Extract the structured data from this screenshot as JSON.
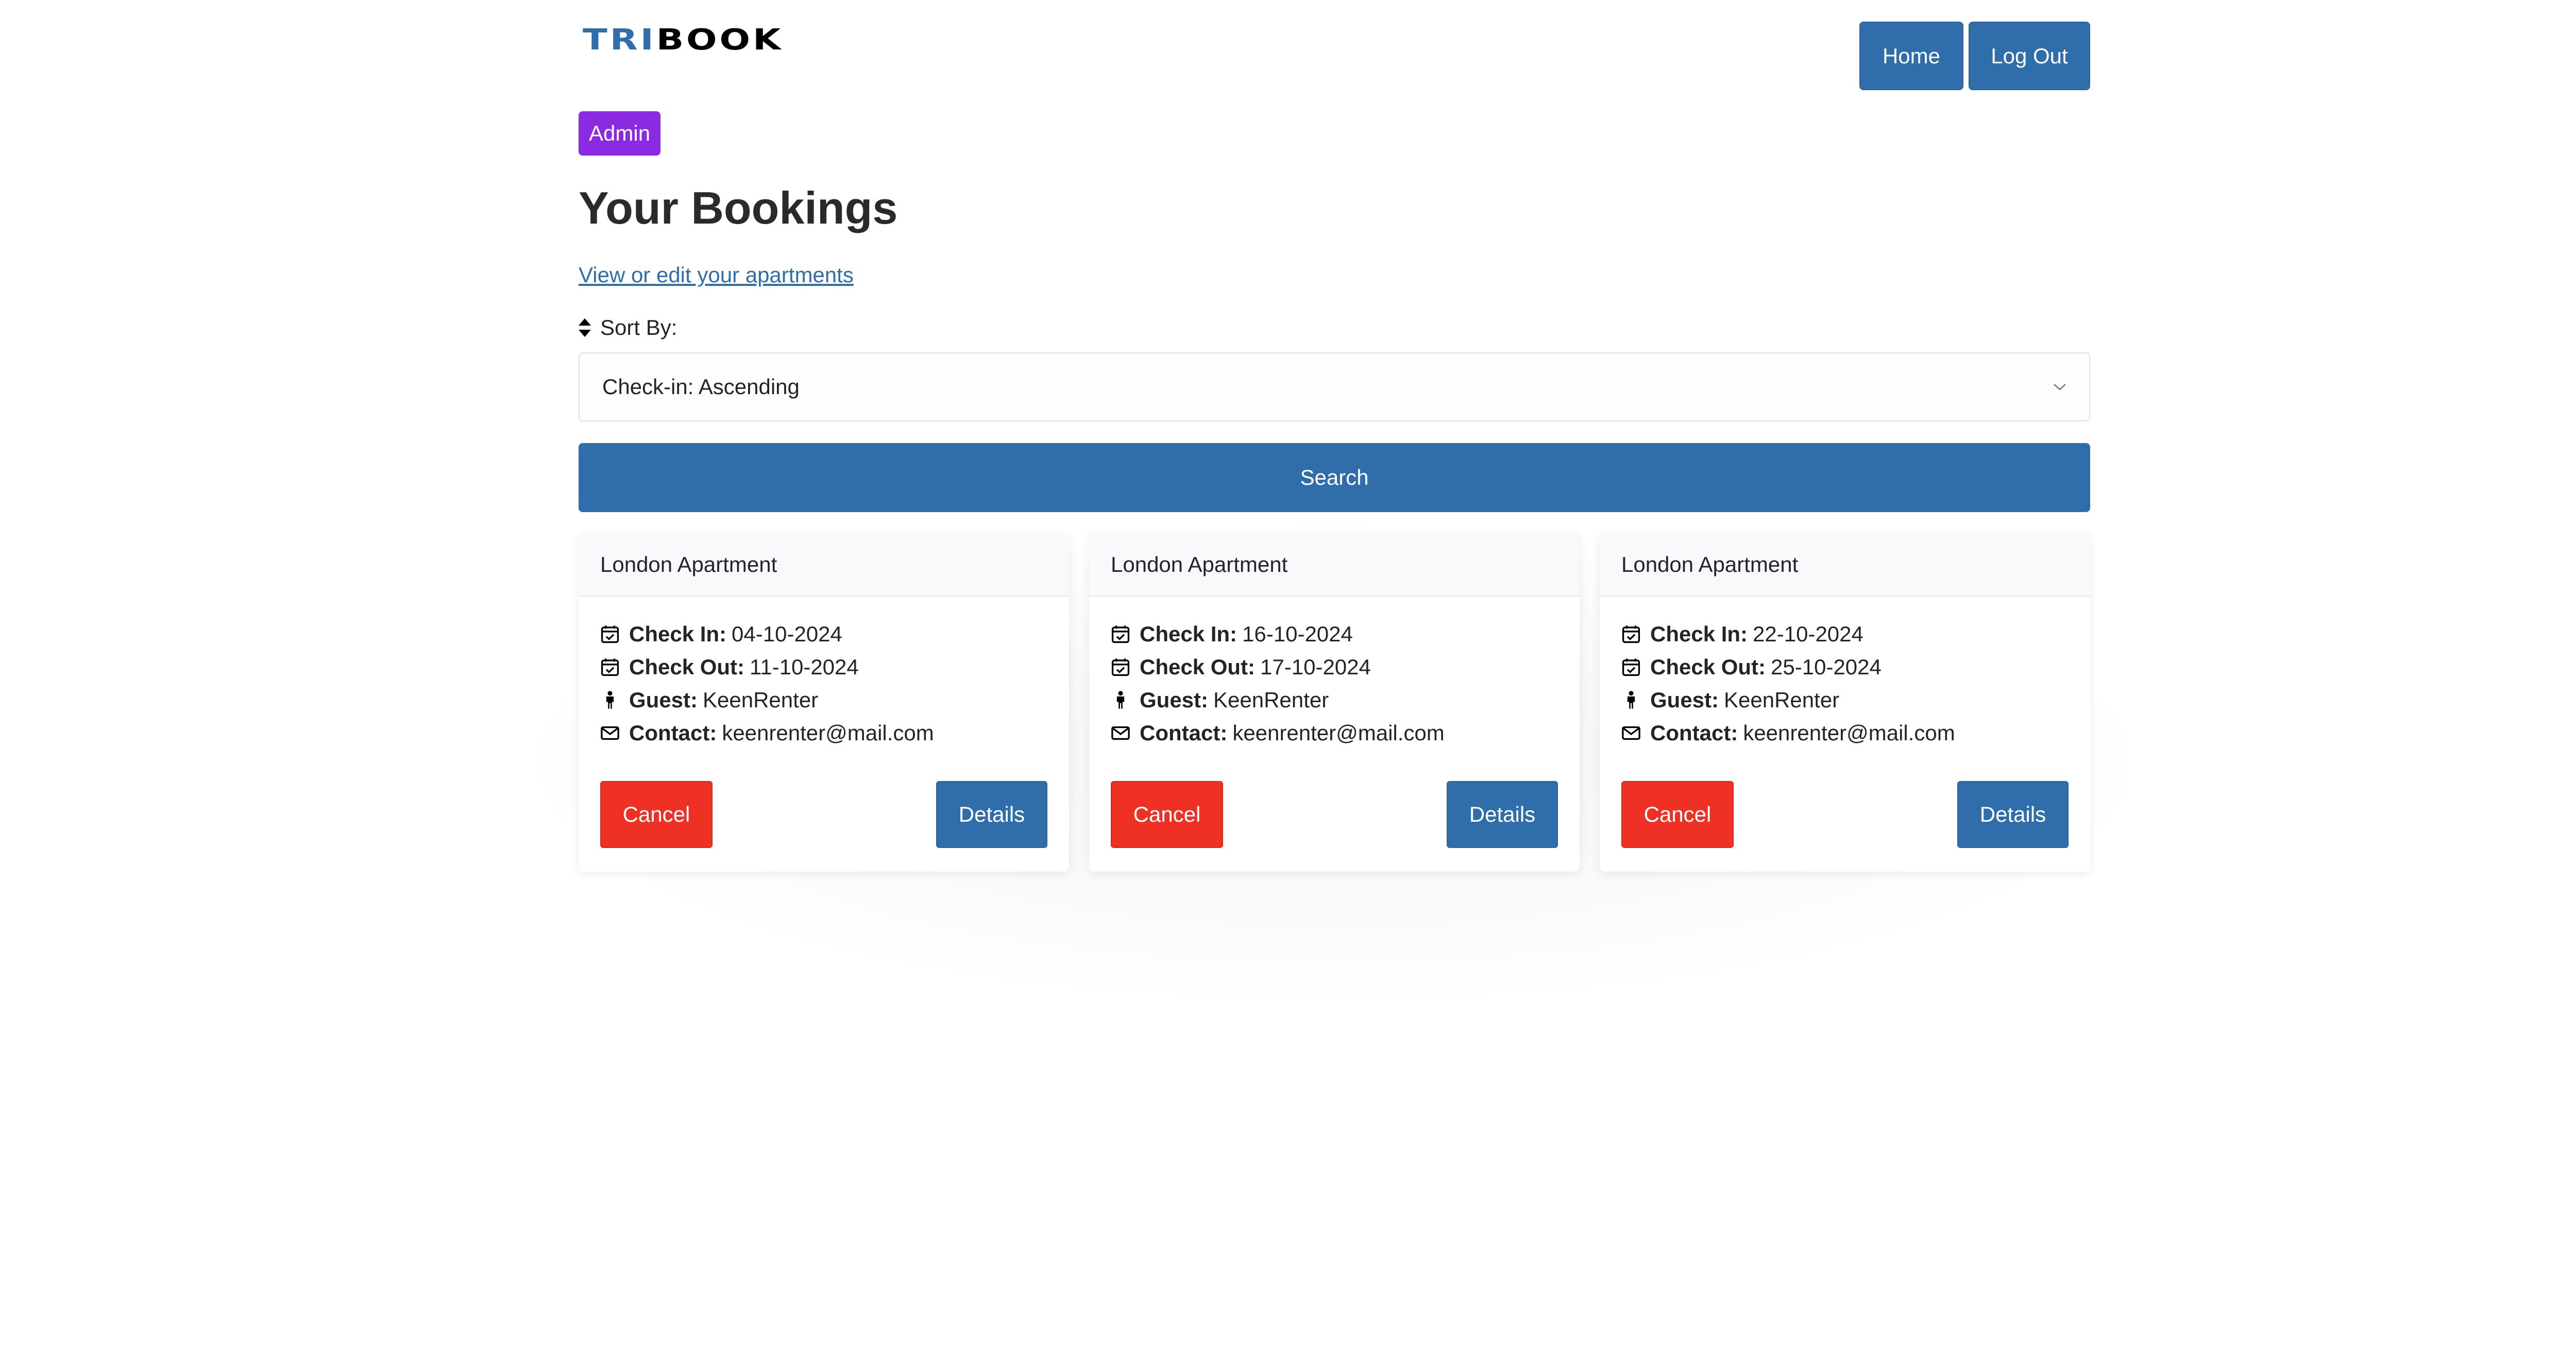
{
  "navbar": {
    "logo_part1": "TRI",
    "logo_part2": "BOOK",
    "home_label": "Home",
    "logout_label": "Log Out"
  },
  "badge": {
    "label": "Admin",
    "color": "#8a2be2"
  },
  "page": {
    "title": "Your Bookings",
    "apartments_link": "View or edit your apartments"
  },
  "sort": {
    "label": "Sort By:",
    "selected": "Check-in: Ascending",
    "icon": "sort-icon"
  },
  "search": {
    "label": "Search"
  },
  "labels": {
    "check_in": "Check In:",
    "check_out": "Check Out:",
    "guest": "Guest:",
    "contact": "Contact:",
    "cancel": "Cancel",
    "details": "Details"
  },
  "bookings": [
    {
      "title": "London Apartment",
      "check_in": "04-10-2024",
      "check_out": "11-10-2024",
      "guest": "KeenRenter",
      "contact": "keenrenter@mail.com"
    },
    {
      "title": "London Apartment",
      "check_in": "16-10-2024",
      "check_out": "17-10-2024",
      "guest": "KeenRenter",
      "contact": "keenrenter@mail.com"
    },
    {
      "title": "London Apartment",
      "check_in": "22-10-2024",
      "check_out": "25-10-2024",
      "guest": "KeenRenter",
      "contact": "keenrenter@mail.com"
    }
  ],
  "colors": {
    "primary": "#2f6eaa",
    "danger": "#ee3124",
    "admin": "#8a2be2"
  }
}
